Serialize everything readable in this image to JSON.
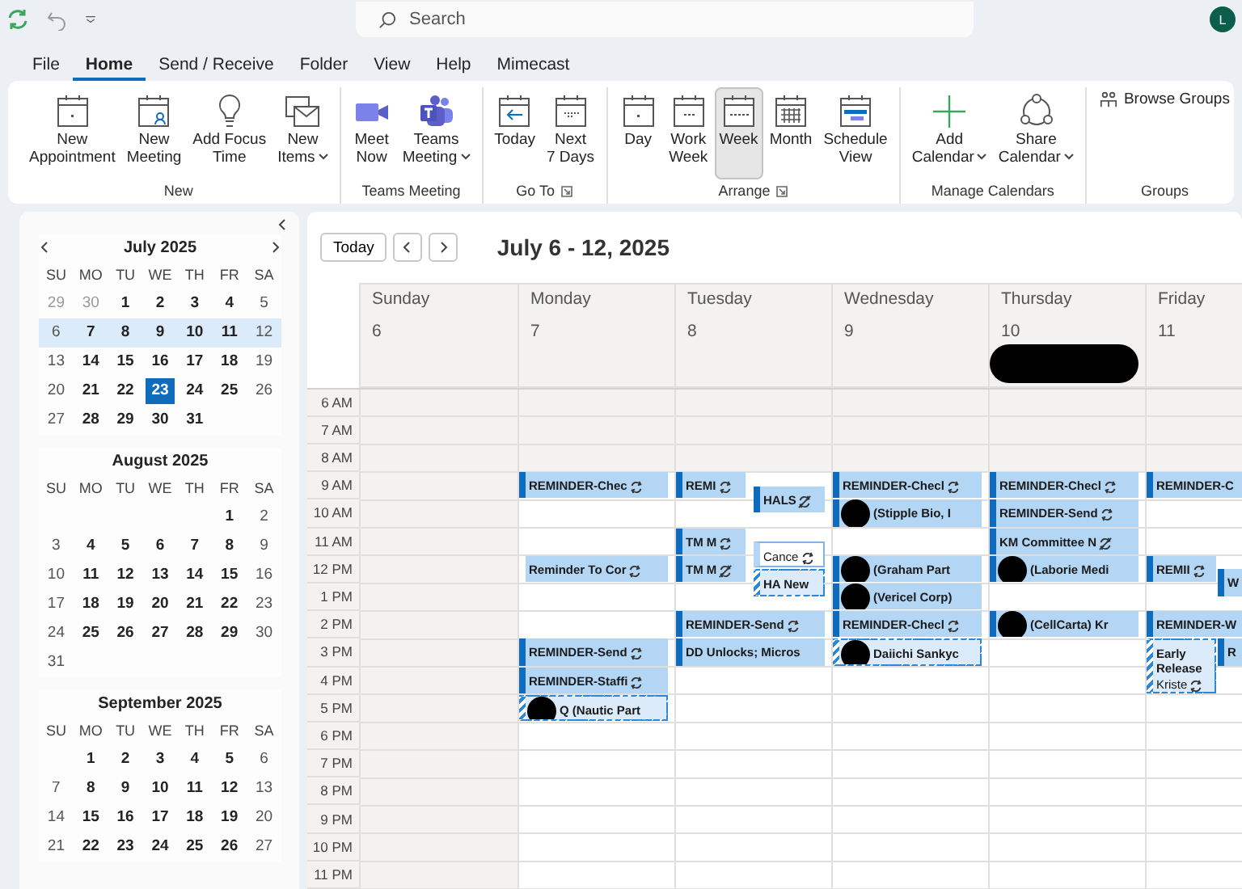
{
  "search": {
    "placeholder": "Search"
  },
  "account": {
    "initials": "L"
  },
  "menu_tabs": [
    {
      "label": "File",
      "selected": false
    },
    {
      "label": "Home",
      "selected": true
    },
    {
      "label": "Send / Receive",
      "selected": false
    },
    {
      "label": "Folder",
      "selected": false
    },
    {
      "label": "View",
      "selected": false
    },
    {
      "label": "Help",
      "selected": false
    },
    {
      "label": "Mimecast",
      "selected": false
    }
  ],
  "ribbon_groups": [
    {
      "label": "New",
      "launcher": false,
      "buttons": [
        {
          "lines": [
            "New",
            "Appointment"
          ],
          "dropdown": false
        },
        {
          "lines": [
            "New",
            "Meeting"
          ],
          "dropdown": false
        },
        {
          "lines": [
            "Add Focus",
            "Time"
          ],
          "dropdown": false
        },
        {
          "lines": [
            "New",
            "Items"
          ],
          "dropdown": true
        }
      ]
    },
    {
      "label": "Teams Meeting",
      "launcher": false,
      "buttons": [
        {
          "lines": [
            "Meet",
            "Now"
          ],
          "dropdown": false
        },
        {
          "lines": [
            "Teams",
            "Meeting"
          ],
          "dropdown": true
        }
      ]
    },
    {
      "label": "Go To",
      "launcher": true,
      "buttons": [
        {
          "lines": [
            "Today"
          ],
          "dropdown": false
        },
        {
          "lines": [
            "Next",
            "7 Days"
          ],
          "dropdown": false
        }
      ]
    },
    {
      "label": "Arrange",
      "launcher": true,
      "buttons": [
        {
          "lines": [
            "Day"
          ],
          "dropdown": false,
          "selected": false
        },
        {
          "lines": [
            "Work",
            "Week"
          ],
          "dropdown": false,
          "selected": false
        },
        {
          "lines": [
            "Week"
          ],
          "dropdown": false,
          "selected": true
        },
        {
          "lines": [
            "Month"
          ],
          "dropdown": false,
          "selected": false
        },
        {
          "lines": [
            "Schedule",
            "View"
          ],
          "dropdown": false,
          "selected": false
        }
      ]
    },
    {
      "label": "Manage Calendars",
      "launcher": false,
      "buttons": [
        {
          "lines": [
            "Add",
            "Calendar"
          ],
          "dropdown": true
        },
        {
          "lines": [
            "Share",
            "Calendar"
          ],
          "dropdown": true
        }
      ]
    },
    {
      "label": "Groups",
      "launcher": false,
      "buttons": [
        {
          "lines": [
            "Browse Groups"
          ],
          "kind": "small"
        }
      ]
    }
  ],
  "months": [
    {
      "title": "July 2025",
      "show_nav": true,
      "weekdays": [
        "SU",
        "MO",
        "TU",
        "WE",
        "TH",
        "FR",
        "SA"
      ],
      "weeks": [
        {
          "selected": false,
          "days": [
            {
              "d": "29",
              "other": true,
              "today": false
            },
            {
              "d": "30",
              "other": true,
              "today": false
            },
            {
              "d": "1",
              "other": false,
              "today": false
            },
            {
              "d": "2",
              "other": false,
              "today": false
            },
            {
              "d": "3",
              "other": false,
              "today": false
            },
            {
              "d": "4",
              "other": false,
              "today": false
            },
            {
              "d": "5",
              "other": false,
              "today": false
            }
          ]
        },
        {
          "selected": true,
          "days": [
            {
              "d": "6",
              "other": false,
              "today": false
            },
            {
              "d": "7",
              "other": false,
              "today": false
            },
            {
              "d": "8",
              "other": false,
              "today": false
            },
            {
              "d": "9",
              "other": false,
              "today": false
            },
            {
              "d": "10",
              "other": false,
              "today": false
            },
            {
              "d": "11",
              "other": false,
              "today": false
            },
            {
              "d": "12",
              "other": false,
              "today": false
            }
          ]
        },
        {
          "selected": false,
          "days": [
            {
              "d": "13",
              "other": false,
              "today": false
            },
            {
              "d": "14",
              "other": false,
              "today": false
            },
            {
              "d": "15",
              "other": false,
              "today": false
            },
            {
              "d": "16",
              "other": false,
              "today": false
            },
            {
              "d": "17",
              "other": false,
              "today": false
            },
            {
              "d": "18",
              "other": false,
              "today": false
            },
            {
              "d": "19",
              "other": false,
              "today": false
            }
          ]
        },
        {
          "selected": false,
          "days": [
            {
              "d": "20",
              "other": false,
              "today": false
            },
            {
              "d": "21",
              "other": false,
              "today": false
            },
            {
              "d": "22",
              "other": false,
              "today": false
            },
            {
              "d": "23",
              "other": false,
              "today": true
            },
            {
              "d": "24",
              "other": false,
              "today": false
            },
            {
              "d": "25",
              "other": false,
              "today": false
            },
            {
              "d": "26",
              "other": false,
              "today": false
            }
          ]
        },
        {
          "selected": false,
          "days": [
            {
              "d": "27",
              "other": false,
              "today": false
            },
            {
              "d": "28",
              "other": false,
              "today": false
            },
            {
              "d": "29",
              "other": false,
              "today": false
            },
            {
              "d": "30",
              "other": false,
              "today": false
            },
            {
              "d": "31",
              "other": false,
              "today": false
            }
          ]
        }
      ]
    },
    {
      "title": "August 2025",
      "show_nav": false,
      "weekdays": [
        "SU",
        "MO",
        "TU",
        "WE",
        "TH",
        "FR",
        "SA"
      ],
      "weeks": [
        {
          "selected": false,
          "days": [
            {
              "d": "1",
              "other": false,
              "today": false
            },
            {
              "d": "2",
              "other": false,
              "today": false
            }
          ]
        },
        {
          "selected": false,
          "days": [
            {
              "d": "3",
              "other": false,
              "today": false
            },
            {
              "d": "4",
              "other": false,
              "today": false
            },
            {
              "d": "5",
              "other": false,
              "today": false
            },
            {
              "d": "6",
              "other": false,
              "today": false
            },
            {
              "d": "7",
              "other": false,
              "today": false
            },
            {
              "d": "8",
              "other": false,
              "today": false
            },
            {
              "d": "9",
              "other": false,
              "today": false
            }
          ]
        },
        {
          "selected": false,
          "days": [
            {
              "d": "10",
              "other": false,
              "today": false
            },
            {
              "d": "11",
              "other": false,
              "today": false
            },
            {
              "d": "12",
              "other": false,
              "today": false
            },
            {
              "d": "13",
              "other": false,
              "today": false
            },
            {
              "d": "14",
              "other": false,
              "today": false
            },
            {
              "d": "15",
              "other": false,
              "today": false
            },
            {
              "d": "16",
              "other": false,
              "today": false
            }
          ]
        },
        {
          "selected": false,
          "days": [
            {
              "d": "17",
              "other": false,
              "today": false
            },
            {
              "d": "18",
              "other": false,
              "today": false
            },
            {
              "d": "19",
              "other": false,
              "today": false
            },
            {
              "d": "20",
              "other": false,
              "today": false
            },
            {
              "d": "21",
              "other": false,
              "today": false
            },
            {
              "d": "22",
              "other": false,
              "today": false
            },
            {
              "d": "23",
              "other": false,
              "today": false
            }
          ]
        },
        {
          "selected": false,
          "days": [
            {
              "d": "24",
              "other": false,
              "today": false
            },
            {
              "d": "25",
              "other": false,
              "today": false
            },
            {
              "d": "26",
              "other": false,
              "today": false
            },
            {
              "d": "27",
              "other": false,
              "today": false
            },
            {
              "d": "28",
              "other": false,
              "today": false
            },
            {
              "d": "29",
              "other": false,
              "today": false
            },
            {
              "d": "30",
              "other": false,
              "today": false
            }
          ]
        },
        {
          "selected": false,
          "days": [
            {
              "d": "31",
              "other": false,
              "today": false
            }
          ]
        }
      ]
    },
    {
      "title": "September 2025",
      "show_nav": false,
      "weekdays": [
        "SU",
        "MO",
        "TU",
        "WE",
        "TH",
        "FR",
        "SA"
      ],
      "weeks": [
        {
          "selected": false,
          "days": [
            {
              "d": "1",
              "other": false,
              "today": false
            },
            {
              "d": "2",
              "other": false,
              "today": false
            },
            {
              "d": "3",
              "other": false,
              "today": false
            },
            {
              "d": "4",
              "other": false,
              "today": false
            },
            {
              "d": "5",
              "other": false,
              "today": false
            },
            {
              "d": "6",
              "other": false,
              "today": false
            }
          ]
        },
        {
          "selected": false,
          "days": [
            {
              "d": "7",
              "other": false,
              "today": false
            },
            {
              "d": "8",
              "other": false,
              "today": false
            },
            {
              "d": "9",
              "other": false,
              "today": false
            },
            {
              "d": "10",
              "other": false,
              "today": false
            },
            {
              "d": "11",
              "other": false,
              "today": false
            },
            {
              "d": "12",
              "other": false,
              "today": false
            },
            {
              "d": "13",
              "other": false,
              "today": false
            }
          ]
        },
        {
          "selected": false,
          "days": [
            {
              "d": "14",
              "other": false,
              "today": false
            },
            {
              "d": "15",
              "other": false,
              "today": false
            },
            {
              "d": "16",
              "other": false,
              "today": false
            },
            {
              "d": "17",
              "other": false,
              "today": false
            },
            {
              "d": "18",
              "other": false,
              "today": false
            },
            {
              "d": "19",
              "other": false,
              "today": false
            },
            {
              "d": "20",
              "other": false,
              "today": false
            }
          ]
        },
        {
          "selected": false,
          "days": [
            {
              "d": "21",
              "other": false,
              "today": false
            },
            {
              "d": "22",
              "other": false,
              "today": false
            },
            {
              "d": "23",
              "other": false,
              "today": false
            },
            {
              "d": "24",
              "other": false,
              "today": false
            },
            {
              "d": "25",
              "other": false,
              "today": false
            },
            {
              "d": "26",
              "other": false,
              "today": false
            },
            {
              "d": "27",
              "other": false,
              "today": false
            }
          ]
        }
      ]
    }
  ],
  "calendar": {
    "today_button": "Today",
    "range_title": "July 6 - 12, 2025",
    "hours": [
      "6 AM",
      "7 AM",
      "8 AM",
      "9 AM",
      "10 AM",
      "11 AM",
      "12 PM",
      "1 PM",
      "2 PM",
      "3 PM",
      "4 PM",
      "5 PM",
      "6 PM",
      "7 PM",
      "8 PM",
      "9 PM",
      "10 PM",
      "11 PM"
    ],
    "days": [
      {
        "name": "Sunday",
        "date": "6",
        "workday": false,
        "redacted": false
      },
      {
        "name": "Monday",
        "date": "7",
        "workday": true,
        "redacted": false,
        "events": [
          {
            "title": "REMINDER-Chec",
            "kind": "busy",
            "recurring": true,
            "exception": false,
            "redacted": false
          },
          {
            "title": "Reminder To Cor",
            "kind": "free",
            "recurring": true,
            "exception": false,
            "redacted": false
          },
          {
            "title": "REMINDER-Send",
            "kind": "busy",
            "recurring": true,
            "exception": false,
            "redacted": false
          },
          {
            "title": "REMINDER-Staffi",
            "kind": "busy",
            "recurring": true,
            "exception": false,
            "redacted": false
          },
          {
            "title": "Q (Nautic Part",
            "kind": "tentative",
            "recurring": false,
            "redacted": true
          }
        ]
      },
      {
        "name": "Tuesday",
        "date": "8",
        "workday": true,
        "redacted": false,
        "events": [
          {
            "title": "REMI",
            "kind": "busy",
            "recurring": true,
            "exception": false,
            "redacted": false
          },
          {
            "title": "HALS",
            "kind": "busy",
            "recurring": true,
            "exception": true,
            "redacted": false
          },
          {
            "title": "TM M",
            "kind": "busy",
            "recurring": true,
            "exception": false,
            "redacted": false
          },
          {
            "title": "Cance",
            "kind": "cancelled",
            "recurring": true,
            "exception": false,
            "redacted": false
          },
          {
            "title": "TM M",
            "kind": "busy",
            "recurring": true,
            "exception": true,
            "redacted": false
          },
          {
            "title": "HA New",
            "kind": "tentative",
            "recurring": false,
            "redacted": false
          },
          {
            "title": "REMINDER-Send",
            "kind": "busy",
            "recurring": true,
            "exception": false,
            "redacted": false
          },
          {
            "title": "DD Unlocks; Micros",
            "kind": "busy",
            "recurring": false,
            "redacted": false
          }
        ]
      },
      {
        "name": "Wednesday",
        "date": "9",
        "workday": true,
        "redacted": false,
        "events": [
          {
            "title": "REMINDER-Checl",
            "kind": "busy",
            "recurring": true,
            "exception": false,
            "redacted": false
          },
          {
            "title": "(Stipple Bio, I",
            "kind": "busy",
            "recurring": false,
            "redacted": true
          },
          {
            "title": "(Graham Part",
            "kind": "busy",
            "recurring": false,
            "redacted": true
          },
          {
            "title": "(Vericel Corp)",
            "kind": "busy",
            "recurring": false,
            "redacted": true
          },
          {
            "title": "REMINDER-Checl",
            "kind": "busy",
            "recurring": true,
            "exception": false,
            "redacted": false
          },
          {
            "title": "Daiichi Sankyc",
            "kind": "tentative",
            "recurring": false,
            "redacted": true
          }
        ]
      },
      {
        "name": "Thursday",
        "date": "10",
        "workday": true,
        "redacted": true,
        "events": [
          {
            "title": "REMINDER-Checl",
            "kind": "busy",
            "recurring": true,
            "exception": false,
            "redacted": false
          },
          {
            "title": "REMINDER-Send",
            "kind": "busy",
            "recurring": true,
            "exception": false,
            "redacted": false
          },
          {
            "title": "KM Committee N",
            "kind": "busy",
            "recurring": true,
            "exception": true,
            "redacted": false
          },
          {
            "title": "(Laborie Medi",
            "kind": "busy",
            "recurring": false,
            "redacted": true
          },
          {
            "title": "(CellCarta)  Kr",
            "kind": "busy",
            "recurring": false,
            "redacted": true
          }
        ]
      },
      {
        "name": "Friday",
        "date": "11",
        "workday": true,
        "redacted": false,
        "events": [
          {
            "title": "REMINDER-C",
            "kind": "busy",
            "recurring": false,
            "redacted": false
          },
          {
            "title": "REMII",
            "kind": "busy",
            "recurring": true,
            "exception": false,
            "redacted": false
          },
          {
            "title": "W",
            "kind": "busy"
          },
          {
            "title": "REMINDER-W",
            "kind": "busy",
            "recurring": false,
            "redacted": false
          },
          {
            "title": "Early Release",
            "location": "Kriste",
            "kind": "tentative",
            "recurring": true,
            "exception": false,
            "redacted": false
          },
          {
            "title": "R",
            "kind": "busy",
            "recurring": false,
            "redacted": false
          }
        ]
      }
    ]
  }
}
